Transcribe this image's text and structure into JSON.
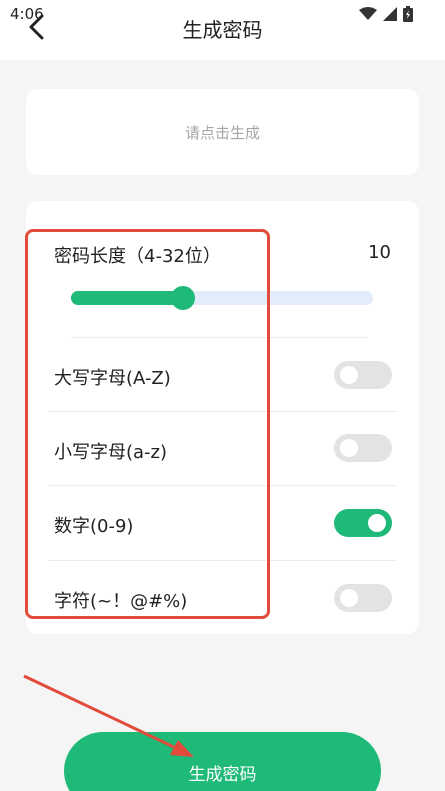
{
  "status": {
    "time": "4:06",
    "icons": [
      "wifi-icon",
      "signal-icon",
      "battery-icon"
    ]
  },
  "header": {
    "title": "生成密码",
    "back_icon": "chevron-left-icon"
  },
  "result": {
    "placeholder": "请点击生成"
  },
  "length": {
    "label": "密码长度（4-32位）",
    "value": "10",
    "min": 4,
    "max": 32,
    "current": 10
  },
  "options": [
    {
      "label": "大写字母(A-Z)",
      "enabled": false
    },
    {
      "label": "小写字母(a-z)",
      "enabled": false
    },
    {
      "label": "数字(0-9)",
      "enabled": true
    },
    {
      "label": "字符(~！@#%)",
      "enabled": false
    }
  ],
  "generate_button": {
    "label": "生成密码"
  },
  "colors": {
    "accent": "#1fb978",
    "annotation": "#e24b3b",
    "toggle_off": "#e3e3e3",
    "slider_track": "#e3ecfb",
    "background": "#f5f5f5"
  }
}
